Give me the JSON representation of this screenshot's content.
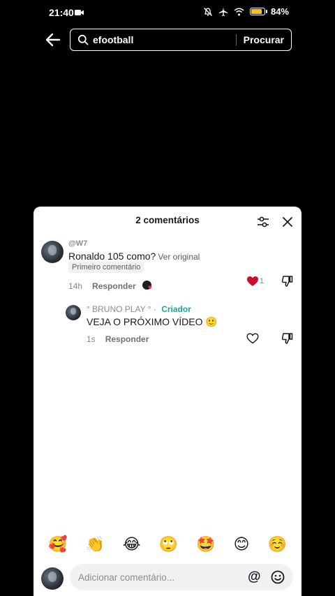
{
  "status_bar": {
    "time": "21:40",
    "battery": "84%",
    "battery_level": 0.84
  },
  "search": {
    "query": "efootball",
    "button_label": "Procurar"
  },
  "comments_sheet": {
    "title": "2 comentários",
    "comments": [
      {
        "username": "@W7",
        "text": "Ronaldo 105 como?",
        "translate_link": "Ver original",
        "badge": "Primeiro comentário",
        "time": "14h",
        "reply_label": "Responder",
        "like_count": "1",
        "liked": true
      },
      {
        "username": "° BRUNO PLAY °",
        "separator": "·",
        "creator_tag": "Criador",
        "text": "VEJA O PRÓXIMO VÍDEO 🙂",
        "time": "1s",
        "reply_label": "Responder"
      }
    ],
    "emoji_bar": [
      "🥰",
      "👏",
      "😂",
      "🙄",
      "🤩",
      "😊",
      "☺️"
    ],
    "input": {
      "placeholder": "Adicionar comentário..."
    }
  }
}
